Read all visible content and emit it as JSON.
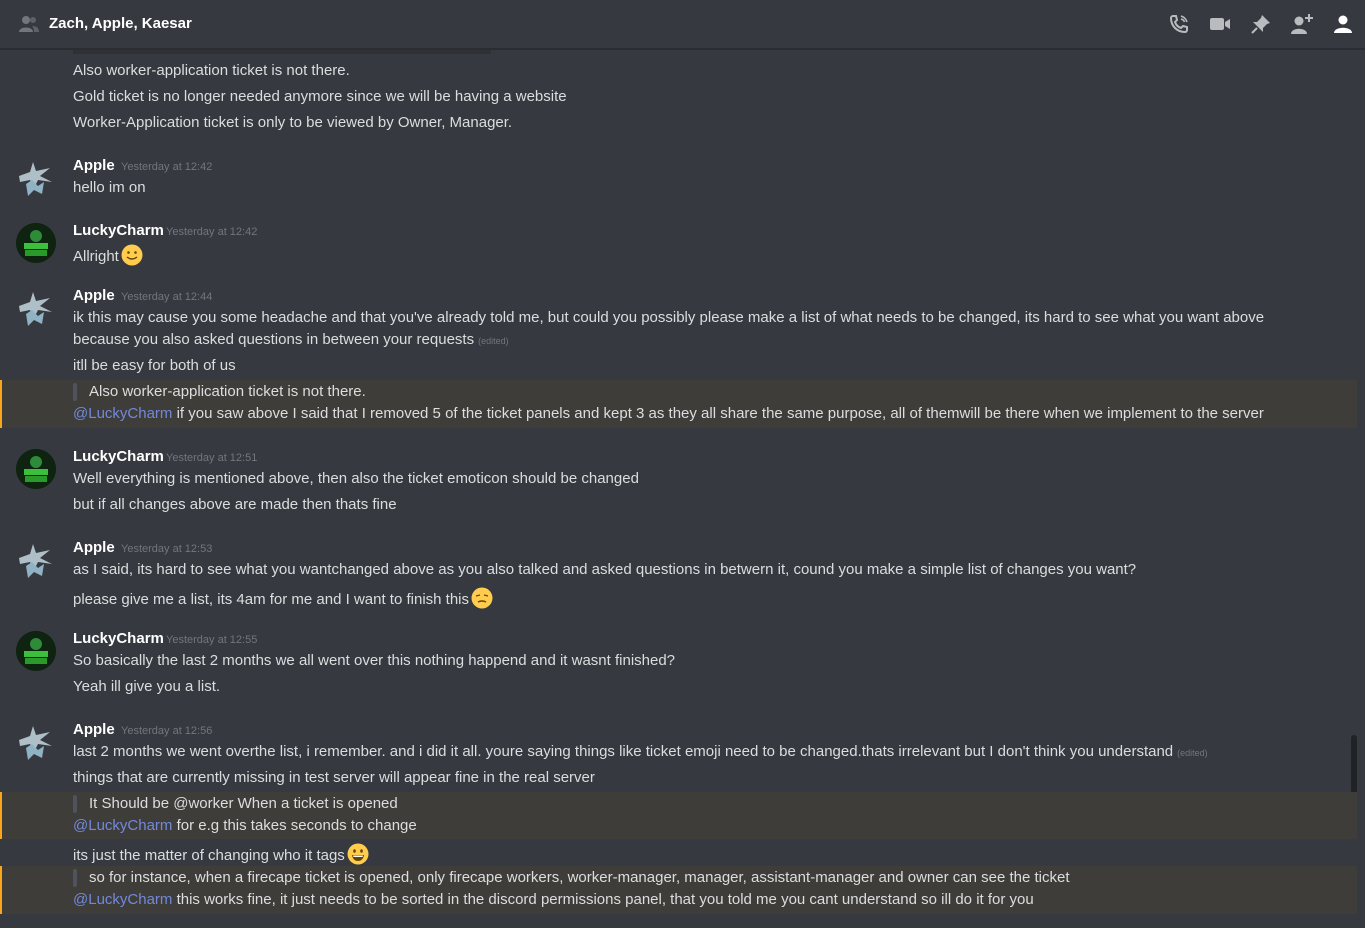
{
  "header": {
    "title": "Zach, Apple, Kaesar",
    "icons": [
      "group-icon",
      "call-icon",
      "video-icon",
      "pin-icon",
      "add-member-icon",
      "member-list-icon"
    ]
  },
  "colors": {
    "background": "#36393f",
    "mention_highlight": "#3f3d3a",
    "mention_bar": "#faa61a",
    "mention_text": "#7289da",
    "timestamp": "#72767d"
  },
  "msg0": {
    "line1": "Also worker-application ticket is not there.",
    "line2": "Gold ticket is no longer needed anymore since we will be having a website",
    "line3": "Worker-Application ticket is only to be viewed by Owner, Manager."
  },
  "msg1": {
    "author": "Apple",
    "time": "Yesterday at 12:42",
    "line1": "hello im on"
  },
  "msg2": {
    "author": "LuckyCharm",
    "time": "Yesterday at 12:42",
    "line1": "Allright",
    "emoji": "slight-smile-emoji"
  },
  "msg3": {
    "author": "Apple",
    "time": "Yesterday at 12:44",
    "line1": "ik this may cause you some headache and that you've already told me, but could you possibly please make a list of what needs to be changed, its hard to see what you want above",
    "line2": "because you also asked questions in between your requests",
    "edited": "(edited)",
    "line3": "itll be easy for both of us",
    "quote": "Also worker-application ticket is not there.",
    "mention": "@LuckyCharm",
    "mention_text": " if you saw above I said that I removed 5 of the ticket panels and kept 3 as they all share the same purpose, all of themwill be there when we implement to the server"
  },
  "msg4": {
    "author": "LuckyCharm",
    "time": "Yesterday at 12:51",
    "line1": "Well everything is mentioned above, then also the ticket emoticon should be changed",
    "line2": "but if all changes above are made then thats fine"
  },
  "msg5": {
    "author": "Apple",
    "time": "Yesterday at 12:53",
    "line1": "as I said, its hard to see what you wantchanged above as  you also talked and asked questions in betwern it, cound you make a simple list of changes you want?",
    "line2": "please give me a list, its 4am for me and I want to  finish this",
    "emoji": "pensive-emoji"
  },
  "msg6": {
    "author": "LuckyCharm",
    "time": "Yesterday at 12:55",
    "line1": "So basically the last 2 months we all went over this nothing happend and it wasnt finished?",
    "line2": "Yeah ill give you a list."
  },
  "msg7": {
    "author": "Apple",
    "time": "Yesterday at 12:56",
    "line1": "last 2 months we went overthe list, i remember. and i did it all. youre saying things like ticket emoji need to be changed.thats irrelevant but I don't think you understand",
    "edited": "(edited)",
    "line2": "things that are currently missing in test server will appear fine in the real server",
    "quote1": "It Should be @worker When a ticket is opened",
    "mention1": "@LuckyCharm",
    "mention1_text": " for e.g this takes seconds to change",
    "line3": "its just the matter of changing who it tags",
    "emoji": "grin-emoji",
    "quote2": "so for instance, when a firecape ticket is opened, only firecape workers, worker-manager, manager, assistant-manager and owner can see the ticket",
    "mention2": "@LuckyCharm",
    "mention2_text": " this works fine, it just needs to be sorted in the discord permissions panel, that you told me you cant understand so ill do it for you"
  }
}
